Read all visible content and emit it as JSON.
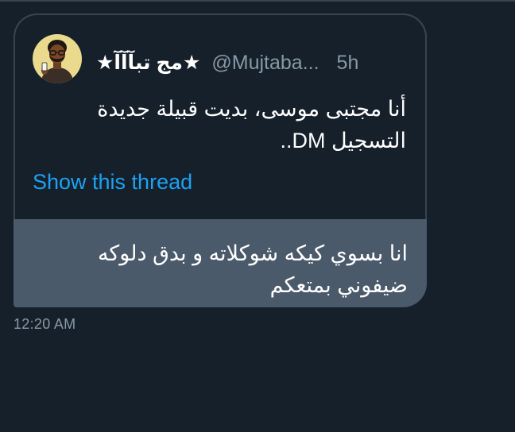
{
  "quoted_tweet": {
    "display_name": "★مج تبآآآ★",
    "handle": "@Mujtaba...",
    "time_ago": "5h",
    "text_lines": [
      "أنا مجتبى موسى، بديت قبيلة جديدة",
      "التسجيل DM.."
    ],
    "show_thread_label": "Show this thread",
    "avatar_icon": "cartoon-avatar-icon"
  },
  "message": {
    "text_lines": [
      "انا بسوي كيكه شوكلاته و بدق دلوكه",
      "ضيفوني بمتعكم"
    ],
    "time": "12:20 AM"
  },
  "colors": {
    "background": "#15202b",
    "bubble": "#4b5a6a",
    "border": "#38444d",
    "link": "#1da1f2",
    "secondary_text": "#8899a6",
    "avatar_background": "#e9da8e"
  }
}
